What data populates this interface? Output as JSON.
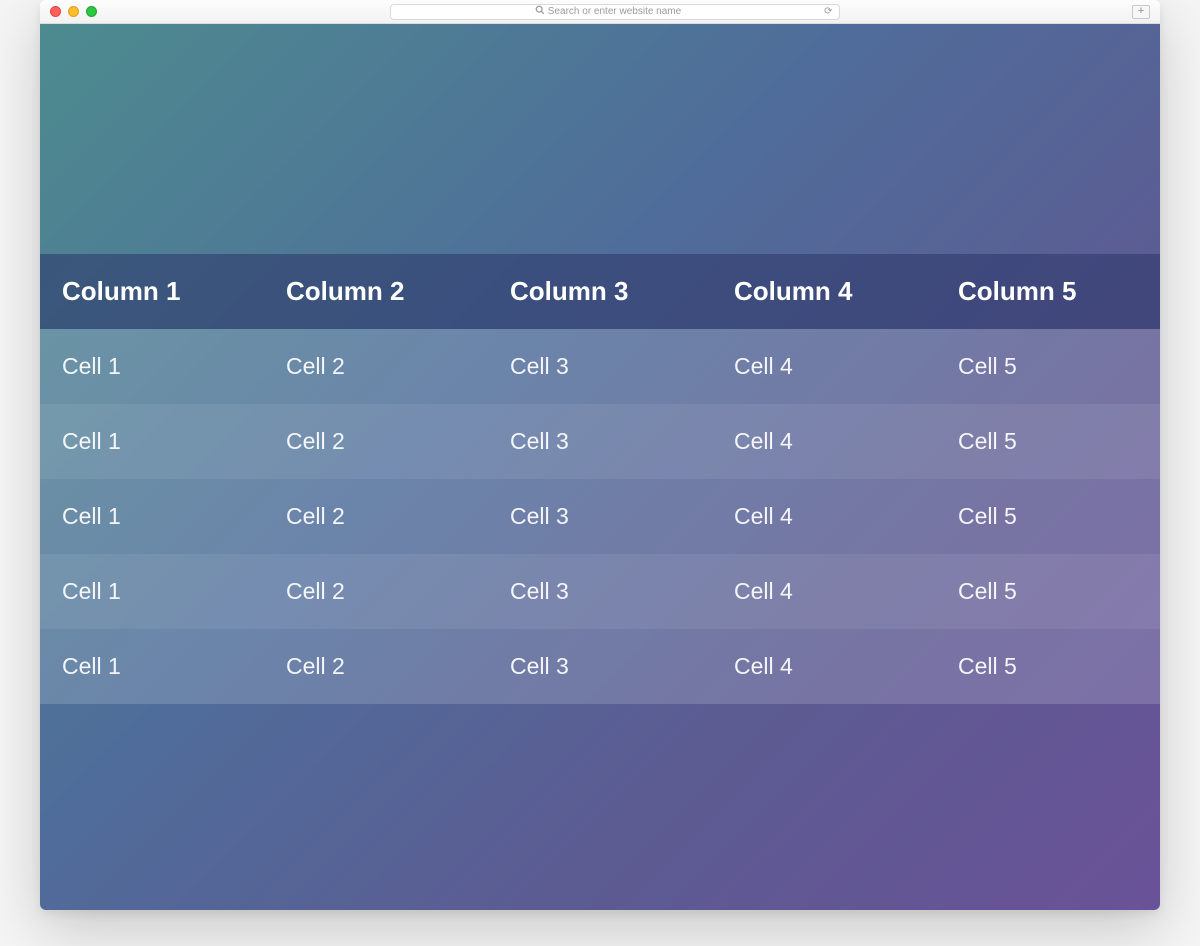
{
  "browser": {
    "search_placeholder": "Search or enter website name"
  },
  "table": {
    "headers": [
      "Column 1",
      "Column 2",
      "Column 3",
      "Column 4",
      "Column 5"
    ],
    "rows": [
      [
        "Cell 1",
        "Cell 2",
        "Cell 3",
        "Cell 4",
        "Cell 5"
      ],
      [
        "Cell 1",
        "Cell 2",
        "Cell 3",
        "Cell 4",
        "Cell 5"
      ],
      [
        "Cell 1",
        "Cell 2",
        "Cell 3",
        "Cell 4",
        "Cell 5"
      ],
      [
        "Cell 1",
        "Cell 2",
        "Cell 3",
        "Cell 4",
        "Cell 5"
      ],
      [
        "Cell 1",
        "Cell 2",
        "Cell 3",
        "Cell 4",
        "Cell 5"
      ]
    ]
  }
}
